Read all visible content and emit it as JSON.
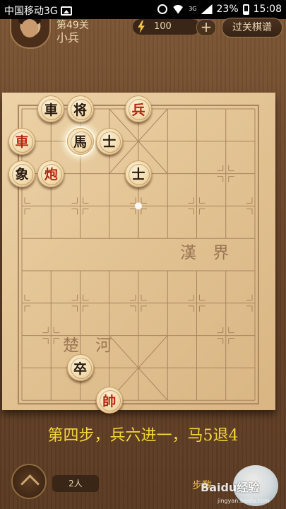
{
  "status_bar": {
    "carrier": "中国移动3G",
    "network": "3G",
    "battery": "23%",
    "time": "15:08"
  },
  "header": {
    "level": "第49关",
    "rank": "小兵",
    "energy": "100",
    "plus": "+",
    "guide_button": "过关棋谱"
  },
  "board": {
    "river_left": "楚 河",
    "river_right": "漢 界",
    "pieces": [
      {
        "id": "black-che-1",
        "char": "車",
        "color": "black",
        "col": 1,
        "row": 0
      },
      {
        "id": "black-jiang",
        "char": "将",
        "color": "black",
        "col": 2,
        "row": 0
      },
      {
        "id": "red-bing-top",
        "char": "兵",
        "color": "red",
        "col": 4,
        "row": 0
      },
      {
        "id": "red-che",
        "char": "車",
        "color": "red",
        "col": 0,
        "row": 1
      },
      {
        "id": "black-ma",
        "char": "馬",
        "color": "black",
        "col": 2,
        "row": 1,
        "selected": true
      },
      {
        "id": "black-shi-1",
        "char": "士",
        "color": "black",
        "col": 3,
        "row": 1
      },
      {
        "id": "black-xiang",
        "char": "象",
        "color": "black",
        "col": 0,
        "row": 2
      },
      {
        "id": "red-pao",
        "char": "炮",
        "color": "red",
        "col": 1,
        "row": 2
      },
      {
        "id": "black-shi-2",
        "char": "士",
        "color": "black",
        "col": 4,
        "row": 2
      },
      {
        "id": "black-zu",
        "char": "卒",
        "color": "black",
        "col": 2,
        "row": 8
      },
      {
        "id": "red-shuai",
        "char": "帥",
        "color": "red",
        "col": 3,
        "row": 9
      }
    ]
  },
  "caption": "第四步，兵六进一，马5退4",
  "footer": {
    "players": "2人",
    "steps_label": "步数",
    "watermark": "Baidu经验",
    "watermark_url": "jingyan.baidu.com"
  },
  "colors": {
    "red_piece": "#b8250f",
    "black_piece": "#2a1a0e",
    "caption": "#f5d63a",
    "board": "#e6c898"
  }
}
